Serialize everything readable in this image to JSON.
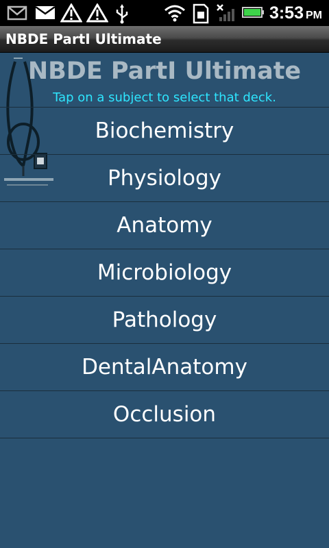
{
  "status_bar": {
    "time": "3:53",
    "ampm": "PM",
    "left_icons": [
      "gmail-icon",
      "email-icon",
      "warning-icon",
      "warning-icon",
      "usb-icon"
    ],
    "right_icons": [
      "wifi-icon",
      "sdcard-icon",
      "signal-off-icon",
      "battery-icon"
    ]
  },
  "title_bar": {
    "title": "NBDE PartI Ultimate"
  },
  "main": {
    "heading": "NBDE PartI Ultimate",
    "subtitle": "Tap on a subject to select that deck.",
    "subjects": [
      "Biochemistry",
      "Physiology",
      "Anatomy",
      "Microbiology",
      "Pathology",
      "DentalAnatomy",
      "Occlusion"
    ]
  },
  "colors": {
    "background": "#2a5170",
    "heading": "#a9b9c4",
    "subtitle": "#2ee6ff",
    "item_text": "#ffffff",
    "divider": "#1a2e3c"
  }
}
